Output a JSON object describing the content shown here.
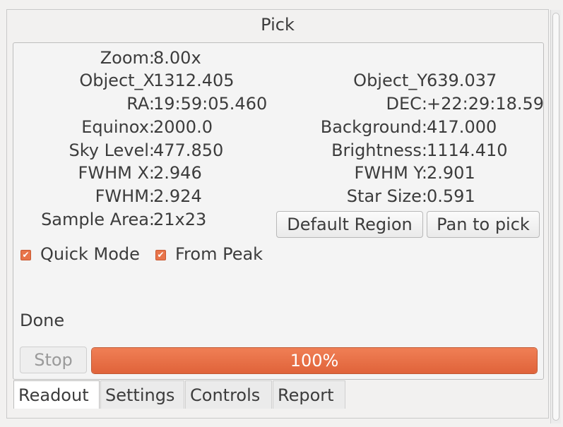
{
  "title": "Pick",
  "readout": {
    "zoom_label": "Zoom:",
    "zoom": "8.00x",
    "objx_label": "Object_X",
    "objx": "1312.405",
    "objy_label": "Object_Y",
    "objy": "639.037",
    "ra_label": "RA:",
    "ra": "19:59:05.460",
    "dec_label": "DEC:",
    "dec": "+22:29:18.59",
    "equinox_label": "Equinox:",
    "equinox": "2000.0",
    "background_label": "Background:",
    "background": "417.000",
    "sky_label": "Sky Level:",
    "sky": "477.850",
    "brightness_label": "Brightness:",
    "brightness": "1114.410",
    "fwhmx_label": "FWHM X:",
    "fwhmx": "2.946",
    "fwhmy_label": "FWHM Y:",
    "fwhmy": "2.901",
    "fwhm_label": "FWHM:",
    "fwhm": "2.924",
    "starsize_label": "Star Size:",
    "starsize": "0.591",
    "sample_label": "Sample Area:",
    "sample": "21x23"
  },
  "buttons": {
    "default_region": "Default Region",
    "pan_to_pick": "Pan to pick",
    "stop": "Stop"
  },
  "checks": {
    "quick_mode": "Quick Mode",
    "from_peak": "From Peak",
    "checkmark": "✔"
  },
  "status": "Done",
  "progress": {
    "value": 1.0,
    "text": "100%"
  },
  "tabs": [
    "Readout",
    "Settings",
    "Controls",
    "Report"
  ],
  "colors": {
    "accent": "#e8744a"
  }
}
